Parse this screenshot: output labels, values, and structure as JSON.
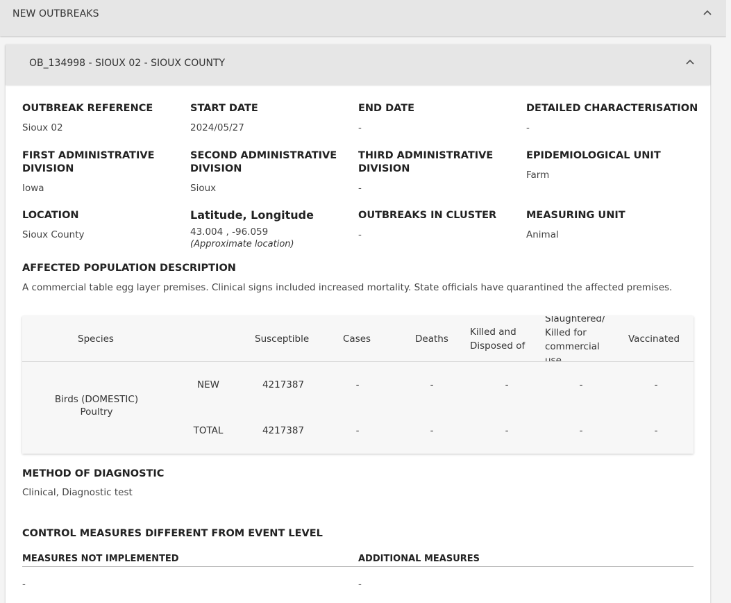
{
  "top_section": {
    "title": "NEW OUTBREAKS"
  },
  "outbreak": {
    "header": "OB_134998 - SIOUX 02 - SIOUX COUNTY",
    "fields": {
      "outbreak_reference": {
        "label": "OUTBREAK REFERENCE",
        "value": "Sioux 02"
      },
      "start_date": {
        "label": "START DATE",
        "value": "2024/05/27"
      },
      "end_date": {
        "label": "END DATE",
        "value": "-"
      },
      "detailed_characterisation": {
        "label": "DETAILED CHARACTERISATION",
        "value": "-"
      },
      "first_admin_division": {
        "label": "FIRST ADMINISTRATIVE DIVISION",
        "value": "Iowa"
      },
      "second_admin_division": {
        "label": "SECOND ADMINISTRATIVE DIVISION",
        "value": "Sioux"
      },
      "third_admin_division": {
        "label": "THIRD ADMINISTRATIVE DIVISION",
        "value": "-"
      },
      "epidemiological_unit": {
        "label": "EPIDEMIOLOGICAL UNIT",
        "value": "Farm"
      },
      "location": {
        "label": "LOCATION",
        "value": "Sioux County"
      },
      "lat_long": {
        "label": "Latitude, Longitude",
        "value": "43.004 , -96.059",
        "note": "(Approximate location)"
      },
      "outbreaks_in_cluster": {
        "label": "OUTBREAKS IN CLUSTER",
        "value": "-"
      },
      "measuring_unit": {
        "label": "MEASURING UNIT",
        "value": "Animal"
      }
    },
    "affected_population": {
      "label": "AFFECTED POPULATION DESCRIPTION",
      "text": "A commercial table egg layer premises. Clinical signs included increased mortality. State officials have quarantined the affected premises."
    },
    "species_table": {
      "headers": {
        "species": "Species",
        "susceptible": "Susceptible",
        "cases": "Cases",
        "deaths": "Deaths",
        "killed_disposed": "Killed and Disposed of",
        "slaughtered": "Slaughtered/ Killed for commercial use",
        "vaccinated": "Vaccinated"
      },
      "species_name_line1": "Birds (DOMESTIC)",
      "species_name_line2": "Poultry",
      "rows": [
        {
          "type": "NEW",
          "susceptible": "4217387",
          "cases": "-",
          "deaths": "-",
          "killed_disposed": "-",
          "slaughtered": "-",
          "vaccinated": "-"
        },
        {
          "type": "TOTAL",
          "susceptible": "4217387",
          "cases": "-",
          "deaths": "-",
          "killed_disposed": "-",
          "slaughtered": "-",
          "vaccinated": "-"
        }
      ]
    },
    "method_of_diagnostic": {
      "label": "METHOD OF DIAGNOSTIC",
      "value": "Clinical, Diagnostic test"
    },
    "control_measures": {
      "label": "CONTROL MEASURES DIFFERENT FROM EVENT LEVEL",
      "not_implemented": {
        "label": "MEASURES NOT IMPLEMENTED",
        "value": "-"
      },
      "additional": {
        "label": "ADDITIONAL MEASURES",
        "value": "-"
      }
    }
  },
  "icons": {
    "collapse": "chevron-up-icon"
  }
}
